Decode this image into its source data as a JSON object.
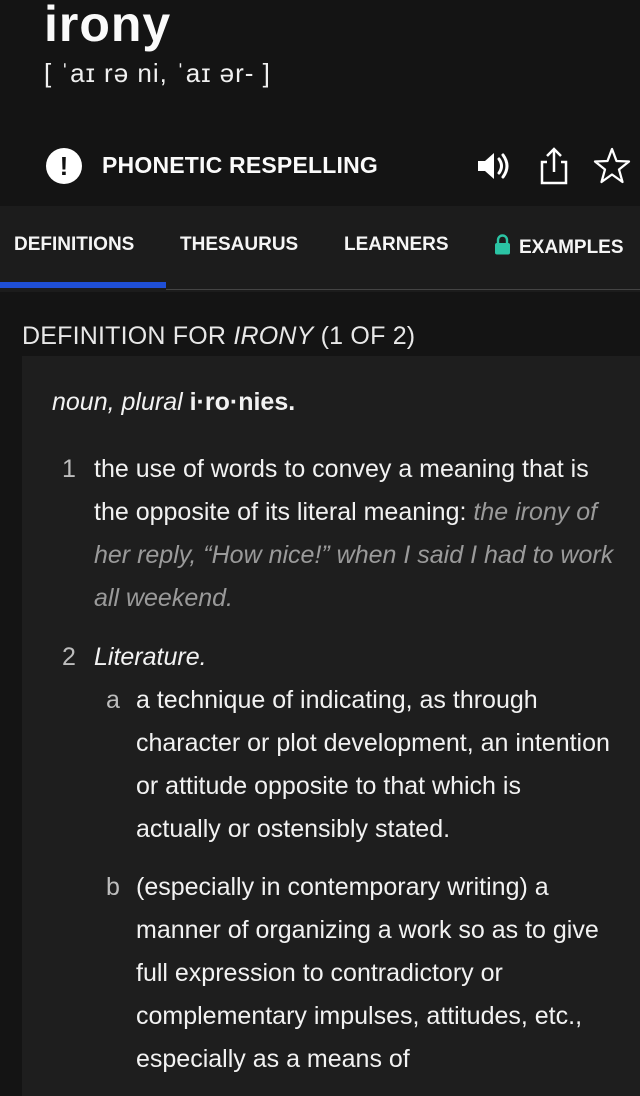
{
  "header": {
    "word": "irony",
    "pronunciation": "[ ˈaɪ rə ni, ˈaɪ ər- ]",
    "phonetic_respelling_label": "PHONETIC RESPELLING",
    "icons": [
      "alert-icon",
      "speaker-icon",
      "share-icon",
      "star-icon"
    ]
  },
  "tabs": [
    {
      "label": "DEFINITIONS",
      "active": true
    },
    {
      "label": "THESAURUS"
    },
    {
      "label": "LEARNERS"
    },
    {
      "label": "EXAMPLES",
      "locked": true
    }
  ],
  "definition": {
    "title_prefix": "DEFINITION FOR ",
    "title_word": "IRONY",
    "title_suffix": " (1 OF 2)",
    "part_of_speech": "noun, plural ",
    "plural_form": "i·ro·nies.",
    "senses": [
      {
        "number": "1",
        "text": "the use of words to convey a meaning that is the opposite of its literal meaning:",
        "example": "the irony of her reply, “How nice!” when I said I had to work all weekend."
      },
      {
        "number": "2",
        "label": "Literature.",
        "subsenses": [
          {
            "letter": "a",
            "text": "a technique of indicating, as through character or plot development, an intention or attitude opposite to that which is actually or ostensibly stated."
          },
          {
            "letter": "b",
            "text": "(especially in contemporary writing) a manner of organizing a work so as to give full expression to contradictory or complementary impulses, attitudes, etc., especially as a means of"
          }
        ]
      }
    ]
  },
  "colors": {
    "background": "#141414",
    "tabbar": "#1c1c1c",
    "card": "#1e1e1e",
    "accent_underline": "#1f4fd6",
    "lock": "#2bc4a4"
  }
}
